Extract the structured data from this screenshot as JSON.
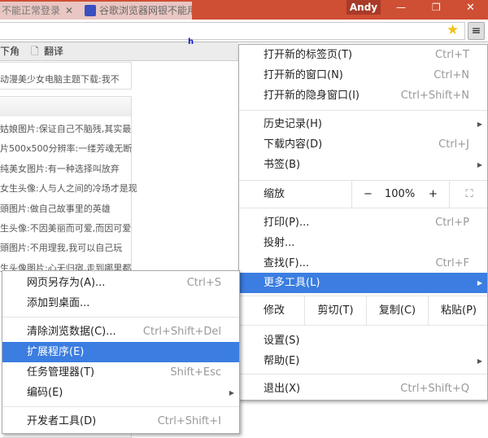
{
  "window": {
    "user": "Andy",
    "minimize": "—",
    "restore": "❐",
    "close": "✕"
  },
  "tabs": [
    {
      "title": "不能正常登录",
      "close": "✕"
    },
    {
      "title": "谷歌浏览器网银不能用了"
    }
  ],
  "bookmarks": [
    {
      "label": "下角"
    },
    {
      "label": "翻译"
    }
  ],
  "page": {
    "top_line": "动漫美少女电脑主题下载:我不",
    "lines": [
      "姑娘图片:保证自己不脑残,其实最",
      "片500x500分辨率:一缕芳魂无断",
      "纯美女图片:有一种选择叫放弃",
      "女生头像:人与人之间的冷场才是现",
      "頭图片:做自己故事里的英雄",
      "生头像:不因美丽而可爱,而因可爱",
      "頭图片:不用理我,我可以自己玩",
      "生头像图片:心无归宿,走到哪里都"
    ],
    "stray": "h"
  },
  "main_menu": {
    "items": [
      {
        "label": "打开新的标签页(T)",
        "shortcut": "Ctrl+T"
      },
      {
        "label": "打开新的窗口(N)",
        "shortcut": "Ctrl+N"
      },
      {
        "label": "打开新的隐身窗口(I)",
        "shortcut": "Ctrl+Shift+N"
      },
      {
        "label": "历史记录(H)"
      },
      {
        "label": "下载内容(D)",
        "shortcut": "Ctrl+J"
      },
      {
        "label": "书签(B)"
      },
      {
        "label": "打印(P)...",
        "shortcut": "Ctrl+P"
      },
      {
        "label": "投射..."
      },
      {
        "label": "查找(F)...",
        "shortcut": "Ctrl+F"
      },
      {
        "label": "更多工具(L)"
      },
      {
        "label": "设置(S)"
      },
      {
        "label": "帮助(E)"
      },
      {
        "label": "退出(X)",
        "shortcut": "Ctrl+Shift+Q"
      }
    ],
    "zoom": {
      "label": "缩放",
      "minus": "−",
      "value": "100%",
      "plus": "+"
    },
    "edit": {
      "label": "修改",
      "cut": "剪切(T)",
      "copy": "复制(C)",
      "paste": "粘贴(P)"
    }
  },
  "submenu": {
    "items": [
      {
        "label": "网页另存为(A)...",
        "shortcut": "Ctrl+S"
      },
      {
        "label": "添加到桌面..."
      },
      {
        "label": "清除浏览数据(C)...",
        "shortcut": "Ctrl+Shift+Del"
      },
      {
        "label": "扩展程序(E)"
      },
      {
        "label": "任务管理器(T)",
        "shortcut": "Shift+Esc"
      },
      {
        "label": "编码(E)"
      },
      {
        "label": "开发者工具(D)",
        "shortcut": "Ctrl+Shift+I"
      }
    ]
  },
  "colors": {
    "titlebar": "#cf4f34",
    "highlight": "#3b7de0"
  }
}
